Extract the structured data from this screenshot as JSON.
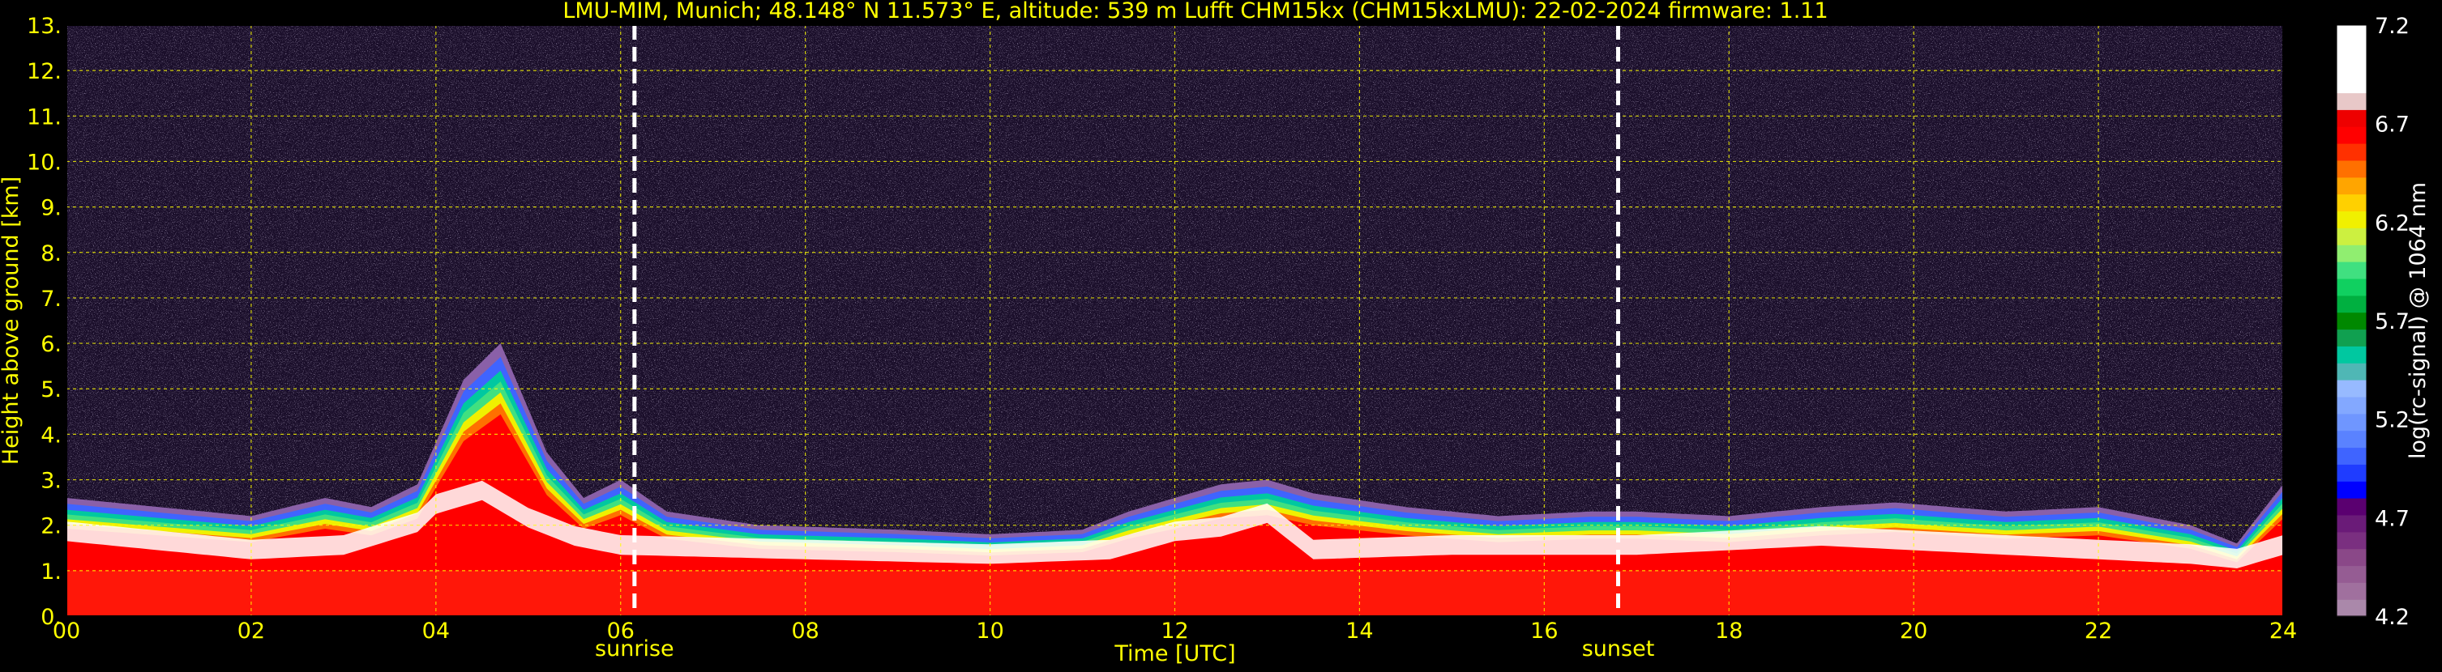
{
  "chart_data": {
    "type": "heatmap",
    "title": "LMU-MIM, Munich; 48.148° N 11.573° E, altitude: 539 m    Lufft CHM15kx (CHM15kxLMU): 22-02-2024    firmware: 1.11",
    "xlabel": "Time [UTC]",
    "ylabel": "Height above ground [km]",
    "xlim": [
      0,
      24
    ],
    "ylim": [
      0,
      13
    ],
    "x_ticks": [
      "00",
      "02",
      "04",
      "06",
      "08",
      "10",
      "12",
      "14",
      "16",
      "18",
      "20",
      "22",
      "24"
    ],
    "y_ticks": [
      "0.",
      "1.",
      "2.",
      "3.",
      "4.",
      "5.",
      "6.",
      "7.",
      "8.",
      "9.",
      "10.",
      "11.",
      "12.",
      "13."
    ],
    "grid": true,
    "events": [
      {
        "label": "sunrise",
        "time": 6.15
      },
      {
        "label": "sunset",
        "time": 16.8
      }
    ],
    "colorbar": {
      "label": "log(rc-signal) @ 1064 nm",
      "range": [
        4.2,
        7.2
      ],
      "ticks": [
        "4.2",
        "4.7",
        "5.2",
        "5.7",
        "6.2",
        "6.7",
        "7.2"
      ],
      "colors": [
        "#aa88aa",
        "#a0709e",
        "#955c93",
        "#8a4888",
        "#7a2f80",
        "#6a1b78",
        "#5a0070",
        "#0000ff",
        "#1f3cff",
        "#3f64ff",
        "#5a82ff",
        "#6f96ff",
        "#83a8ff",
        "#97baff",
        "#4fb7b5",
        "#00c8a0",
        "#10a050",
        "#008800",
        "#00b040",
        "#10d060",
        "#40e080",
        "#90ee70",
        "#ccf040",
        "#f0f000",
        "#ffd000",
        "#ffa500",
        "#ff7000",
        "#ff3000",
        "#ff0000",
        "#ee0000",
        "#e8c8c8",
        "#ffffff",
        "#ffffff",
        "#ffffff",
        "#ffffff"
      ]
    },
    "boundary_layer_top_km": [
      [
        0,
        2.6
      ],
      [
        1,
        2.4
      ],
      [
        2,
        2.2
      ],
      [
        2.8,
        2.6
      ],
      [
        3.3,
        2.4
      ],
      [
        3.8,
        2.9
      ],
      [
        4.3,
        5.2
      ],
      [
        4.7,
        6.0
      ],
      [
        5.2,
        3.6
      ],
      [
        5.6,
        2.6
      ],
      [
        6,
        3.0
      ],
      [
        6.5,
        2.3
      ],
      [
        7.5,
        2.0
      ],
      [
        9,
        1.9
      ],
      [
        10,
        1.8
      ],
      [
        11,
        1.9
      ],
      [
        11.5,
        2.3
      ],
      [
        12,
        2.6
      ],
      [
        12.5,
        2.9
      ],
      [
        13,
        3.0
      ],
      [
        13.5,
        2.7
      ],
      [
        14.5,
        2.4
      ],
      [
        15.5,
        2.2
      ],
      [
        16.5,
        2.3
      ],
      [
        17,
        2.3
      ],
      [
        18,
        2.2
      ],
      [
        19,
        2.4
      ],
      [
        19.8,
        2.5
      ],
      [
        21,
        2.3
      ],
      [
        22,
        2.4
      ],
      [
        23,
        2.0
      ],
      [
        23.5,
        1.6
      ],
      [
        24,
        2.9
      ]
    ],
    "cloud_base_km": [
      [
        0,
        1.9
      ],
      [
        1,
        1.7
      ],
      [
        2,
        1.5
      ],
      [
        3,
        1.6
      ],
      [
        3.8,
        2.1
      ],
      [
        4,
        2.5
      ],
      [
        4.5,
        2.8
      ],
      [
        5,
        2.2
      ],
      [
        5.5,
        1.8
      ],
      [
        6,
        1.6
      ],
      [
        8,
        1.5
      ],
      [
        10,
        1.4
      ],
      [
        11.3,
        1.5
      ],
      [
        12,
        1.9
      ],
      [
        12.5,
        2.0
      ],
      [
        13,
        2.3
      ],
      [
        13.5,
        1.5
      ],
      [
        15,
        1.6
      ],
      [
        16,
        1.6
      ],
      [
        17,
        1.6
      ],
      [
        18,
        1.7
      ],
      [
        19,
        1.8
      ],
      [
        20,
        1.7
      ],
      [
        21,
        1.6
      ],
      [
        22,
        1.5
      ],
      [
        23,
        1.4
      ],
      [
        23.5,
        1.3
      ],
      [
        24,
        1.6
      ]
    ]
  }
}
